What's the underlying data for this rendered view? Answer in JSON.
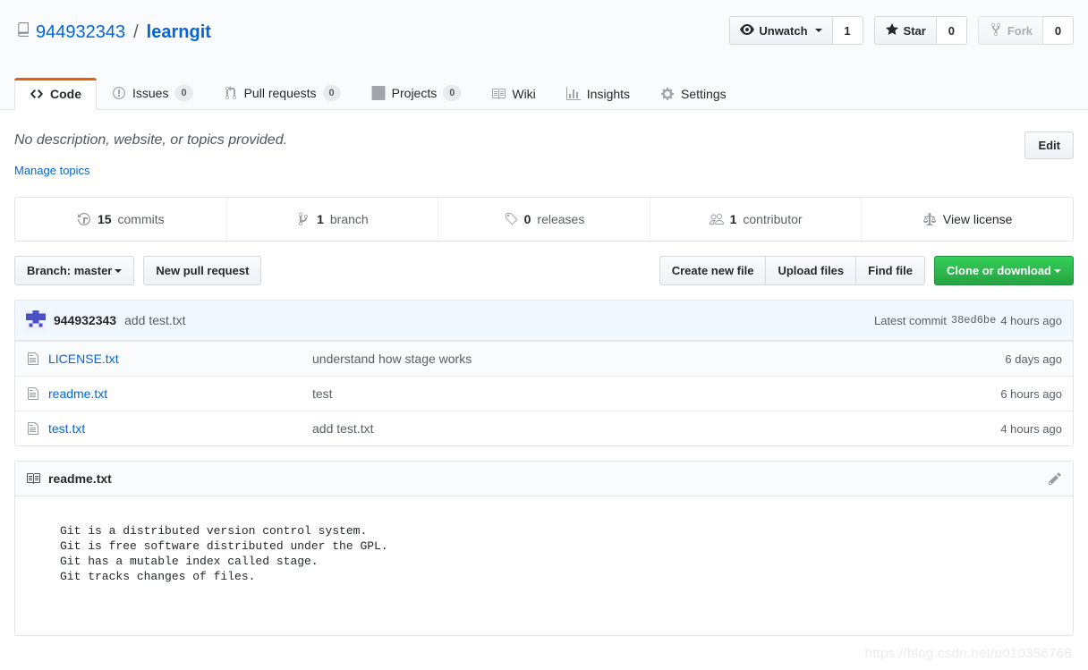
{
  "header": {
    "repo_icon": "repo-book-icon",
    "owner": "944932343",
    "separator": "/",
    "name": "learngit",
    "social": {
      "watch_label": "Unwatch",
      "watch_count": "1",
      "watch_icon": "eye-icon",
      "star_label": "Star",
      "star_count": "0",
      "star_icon": "star-icon",
      "fork_label": "Fork",
      "fork_count": "0",
      "fork_icon": "fork-icon"
    },
    "tabs": [
      {
        "label": "Code",
        "count": null,
        "icon": "code-icon",
        "selected": true
      },
      {
        "label": "Issues",
        "count": "0",
        "icon": "issue-opened-icon",
        "selected": false
      },
      {
        "label": "Pull requests",
        "count": "0",
        "icon": "git-pull-request-icon",
        "selected": false
      },
      {
        "label": "Projects",
        "count": "0",
        "icon": "project-board-icon",
        "selected": false
      },
      {
        "label": "Wiki",
        "count": null,
        "icon": "book-icon",
        "selected": false
      },
      {
        "label": "Insights",
        "count": null,
        "icon": "graph-bar-icon",
        "selected": false
      },
      {
        "label": "Settings",
        "count": null,
        "icon": "gear-icon",
        "selected": false
      }
    ]
  },
  "description": {
    "text": "No description, website, or topics provided.",
    "manage_topics_label": "Manage topics",
    "edit_label": "Edit"
  },
  "stats": [
    {
      "num": "15",
      "label": "commits",
      "icon": "history-icon"
    },
    {
      "num": "1",
      "label": "branch",
      "icon": "git-branch-icon"
    },
    {
      "num": "0",
      "label": "releases",
      "icon": "tag-icon"
    },
    {
      "num": "1",
      "label": "contributor",
      "icon": "people-icon"
    },
    {
      "num": "",
      "label": "View license",
      "icon": "law-icon"
    }
  ],
  "toolbar": {
    "branch_label": "Branch: master",
    "new_pull_request_label": "New pull request",
    "create_new_file_label": "Create new file",
    "upload_files_label": "Upload files",
    "find_file_label": "Find file",
    "clone_or_download_label": "Clone or download"
  },
  "latest_commit": {
    "author": "944932343",
    "message": "add test.txt",
    "prefix": "Latest commit",
    "sha": "38ed6be",
    "age": "4 hours ago",
    "avatar_icon": "identicon-avatar"
  },
  "files": [
    {
      "name": "LICENSE.txt",
      "message": "understand how stage works",
      "age": "6 days ago",
      "icon": "file-text-icon"
    },
    {
      "name": "readme.txt",
      "message": "test",
      "age": "6 hours ago",
      "icon": "file-text-icon"
    },
    {
      "name": "test.txt",
      "message": "add test.txt",
      "age": "4 hours ago",
      "icon": "file-text-icon"
    }
  ],
  "readme": {
    "title": "readme.txt",
    "title_icon": "book-icon",
    "edit_icon": "pencil-icon",
    "content": "Git is a distributed version control system.\nGit is free software distributed under the GPL.\nGit has a mutable index called stage.\nGit tracks changes of files."
  },
  "watermark": "https://blog.csdn.net/u010356768",
  "colors": {
    "accent_orange": "#e36209",
    "link_blue": "#0366d6",
    "green_button": "#28a745",
    "commit_bar_blue": "#f1f8ff"
  }
}
